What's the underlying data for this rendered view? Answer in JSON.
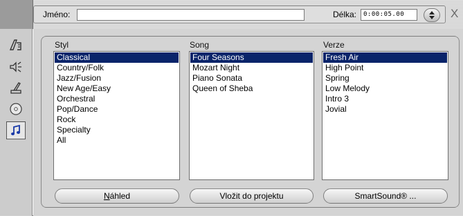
{
  "header": {
    "name_label": "Jméno:",
    "name_value": "",
    "length_label": "Délka:",
    "length_value": "0:00:05.00",
    "close_label": "X"
  },
  "sidebar": {
    "items": [
      {
        "icon": "title-icon"
      },
      {
        "icon": "speaker-icon"
      },
      {
        "icon": "paint-icon"
      },
      {
        "icon": "disc-icon"
      },
      {
        "icon": "music-note-icon",
        "active": true
      }
    ]
  },
  "columns": {
    "style": {
      "label": "Styl",
      "items": [
        "Classical",
        "Country/Folk",
        "Jazz/Fusion",
        "New Age/Easy",
        "Orchestral",
        "Pop/Dance",
        "Rock",
        "Specialty",
        "All"
      ],
      "selected": "Classical"
    },
    "song": {
      "label": "Song",
      "items": [
        "Four Seasons",
        "Mozart Night",
        "Piano Sonata",
        "Queen of Sheba"
      ],
      "selected": "Four Seasons"
    },
    "version": {
      "label": "Verze",
      "items": [
        "Fresh Air",
        "High Point",
        "Spring",
        "Low Melody",
        "Intro 3",
        "Jovial"
      ],
      "selected": "Fresh Air"
    }
  },
  "buttons": {
    "preview_first": "N",
    "preview_rest": "áhled",
    "insert": "Vložit do projektu",
    "smartsound": "SmartSound® ..."
  },
  "colors": {
    "selection": "#0a246a",
    "active_icon": "#1a3aa8"
  }
}
